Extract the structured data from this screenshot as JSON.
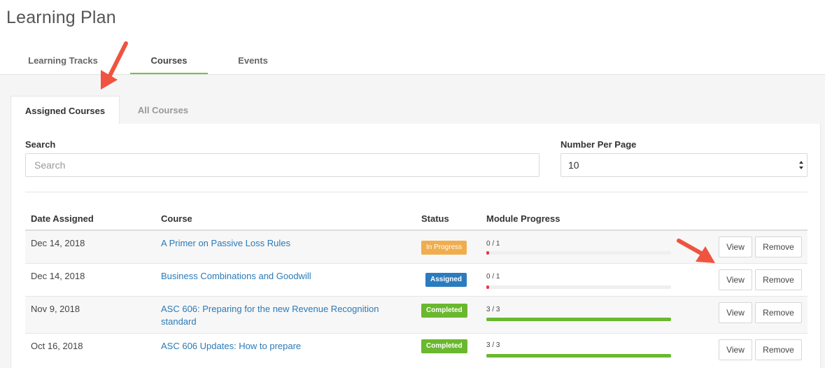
{
  "page": {
    "title": "Learning Plan"
  },
  "main_tabs": [
    {
      "label": "Learning Tracks",
      "active": false
    },
    {
      "label": "Courses",
      "active": true
    },
    {
      "label": "Events",
      "active": false
    }
  ],
  "sub_tabs": [
    {
      "label": "Assigned Courses",
      "active": true
    },
    {
      "label": "All Courses",
      "active": false
    }
  ],
  "search": {
    "label": "Search",
    "placeholder": "Search",
    "value": ""
  },
  "per_page": {
    "label": "Number Per Page",
    "value": "10"
  },
  "table": {
    "headers": {
      "date": "Date Assigned",
      "course": "Course",
      "status": "Status",
      "progress": "Module Progress"
    },
    "rows": [
      {
        "date": "Dec 14, 2018",
        "course": "A Primer on Passive Loss Rules",
        "status": "In Progress",
        "progress_text": "0 / 1",
        "progress": 0
      },
      {
        "date": "Dec 14, 2018",
        "course": "Business Combinations and Goodwill",
        "status": "Assigned",
        "progress_text": "0 / 1",
        "progress": 0
      },
      {
        "date": "Nov 9, 2018",
        "course": "ASC 606: Preparing for the new Revenue Recognition standard",
        "status": "Completed",
        "progress_text": "3 / 3",
        "progress": 1
      },
      {
        "date": "Oct 16, 2018",
        "course": "ASC 606 Updates: How to prepare",
        "status": "Completed",
        "progress_text": "3 / 3",
        "progress": 1
      }
    ],
    "view_label": "View",
    "remove_label": "Remove"
  },
  "colors": {
    "accent": "#7cc142",
    "link": "#2a7ab8",
    "in_progress": "#f0ad4e",
    "assigned": "#2b7bbf",
    "completed": "#6ab82e",
    "progress_empty": "#e8364f",
    "annotation_arrow": "#f0533f"
  }
}
